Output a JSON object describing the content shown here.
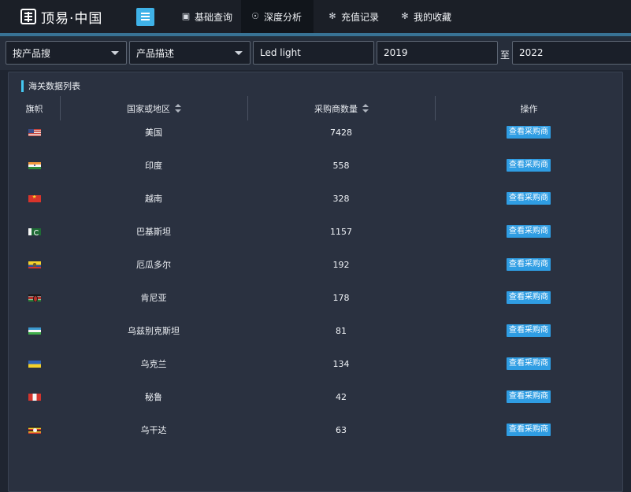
{
  "header": {
    "logo_text": "顶易·中国",
    "nav": [
      {
        "label": "基础查询",
        "icon": "clipboard-icon",
        "active": false
      },
      {
        "label": "深度分析",
        "icon": "users-icon",
        "active": true
      },
      {
        "label": "充值记录",
        "icon": "gear-icon",
        "active": false
      },
      {
        "label": "我的收藏",
        "icon": "gear-icon",
        "active": false
      }
    ]
  },
  "search": {
    "search_type": "按产品搜",
    "field_type": "产品描述",
    "keyword": "Led light",
    "year_from": "2019",
    "to_label": "至",
    "year_to": "2022"
  },
  "panel": {
    "title": "海关数据列表",
    "columns": {
      "flag": "旗帜",
      "country": "国家或地区",
      "buyers": "采购商数量",
      "action": "操作"
    },
    "action_label": "查看采购商",
    "rows": [
      {
        "flag": "us",
        "country": "美国",
        "buyers": "7428"
      },
      {
        "flag": "in",
        "country": "印度",
        "buyers": "558"
      },
      {
        "flag": "vn",
        "country": "越南",
        "buyers": "328"
      },
      {
        "flag": "pk",
        "country": "巴基斯坦",
        "buyers": "1157"
      },
      {
        "flag": "ec",
        "country": "厄瓜多尔",
        "buyers": "192"
      },
      {
        "flag": "ke",
        "country": "肯尼亚",
        "buyers": "178"
      },
      {
        "flag": "uz",
        "country": "乌兹别克斯坦",
        "buyers": "81"
      },
      {
        "flag": "ua",
        "country": "乌克兰",
        "buyers": "134"
      },
      {
        "flag": "pe",
        "country": "秘鲁",
        "buyers": "42"
      },
      {
        "flag": "ug",
        "country": "乌干达",
        "buyers": "63"
      }
    ]
  }
}
